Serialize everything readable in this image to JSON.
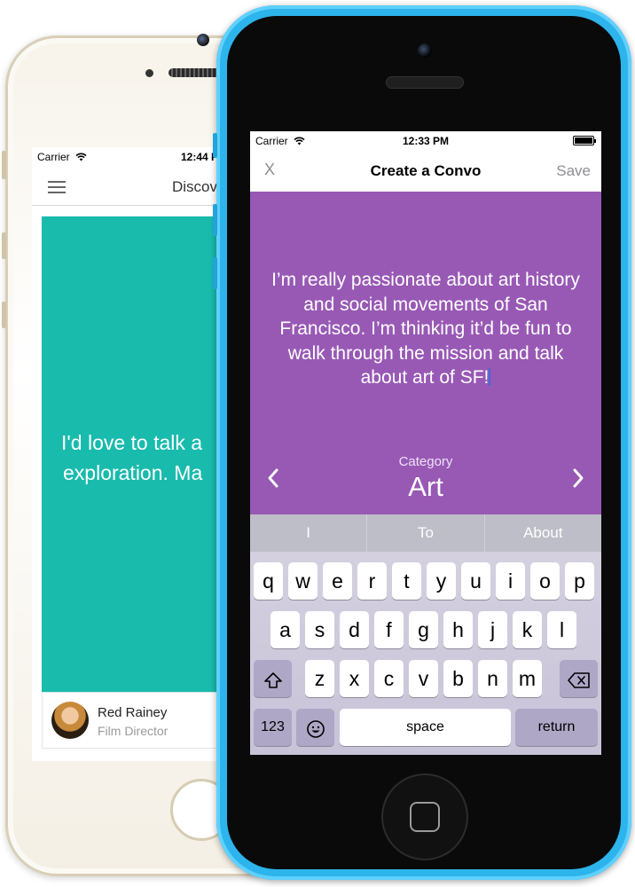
{
  "back_phone": {
    "status": {
      "carrier": "Carrier",
      "time": "12:44 P"
    },
    "nav_title": "Discov",
    "card_text_lines": [
      "I'd love to talk a",
      "exploration. Ma"
    ],
    "profile": {
      "name": "Red Rainey",
      "role": "Film Director"
    }
  },
  "front_phone": {
    "status": {
      "carrier": "Carrier",
      "time": "12:33 PM"
    },
    "nav": {
      "close": "X",
      "title": "Create a Convo",
      "save": "Save"
    },
    "message": "I’m really passionate about art history and social movements of San Francisco. I’m thinking it’d be fun to walk through the mission and talk about art of SF!",
    "category": {
      "label": "Category",
      "value": "Art"
    },
    "suggestions": [
      "I",
      "To",
      "About"
    ],
    "keyboard": {
      "row1": [
        "q",
        "w",
        "e",
        "r",
        "t",
        "y",
        "u",
        "i",
        "o",
        "p"
      ],
      "row2": [
        "a",
        "s",
        "d",
        "f",
        "g",
        "h",
        "j",
        "k",
        "l"
      ],
      "row3": [
        "z",
        "x",
        "c",
        "v",
        "b",
        "n",
        "m"
      ],
      "numbers_key": "123",
      "space_key": "space",
      "return_key": "return"
    }
  },
  "colors": {
    "accent_purple": "#9859b5",
    "card_teal": "#19bbad",
    "phone_blue": "#2db4ec"
  }
}
